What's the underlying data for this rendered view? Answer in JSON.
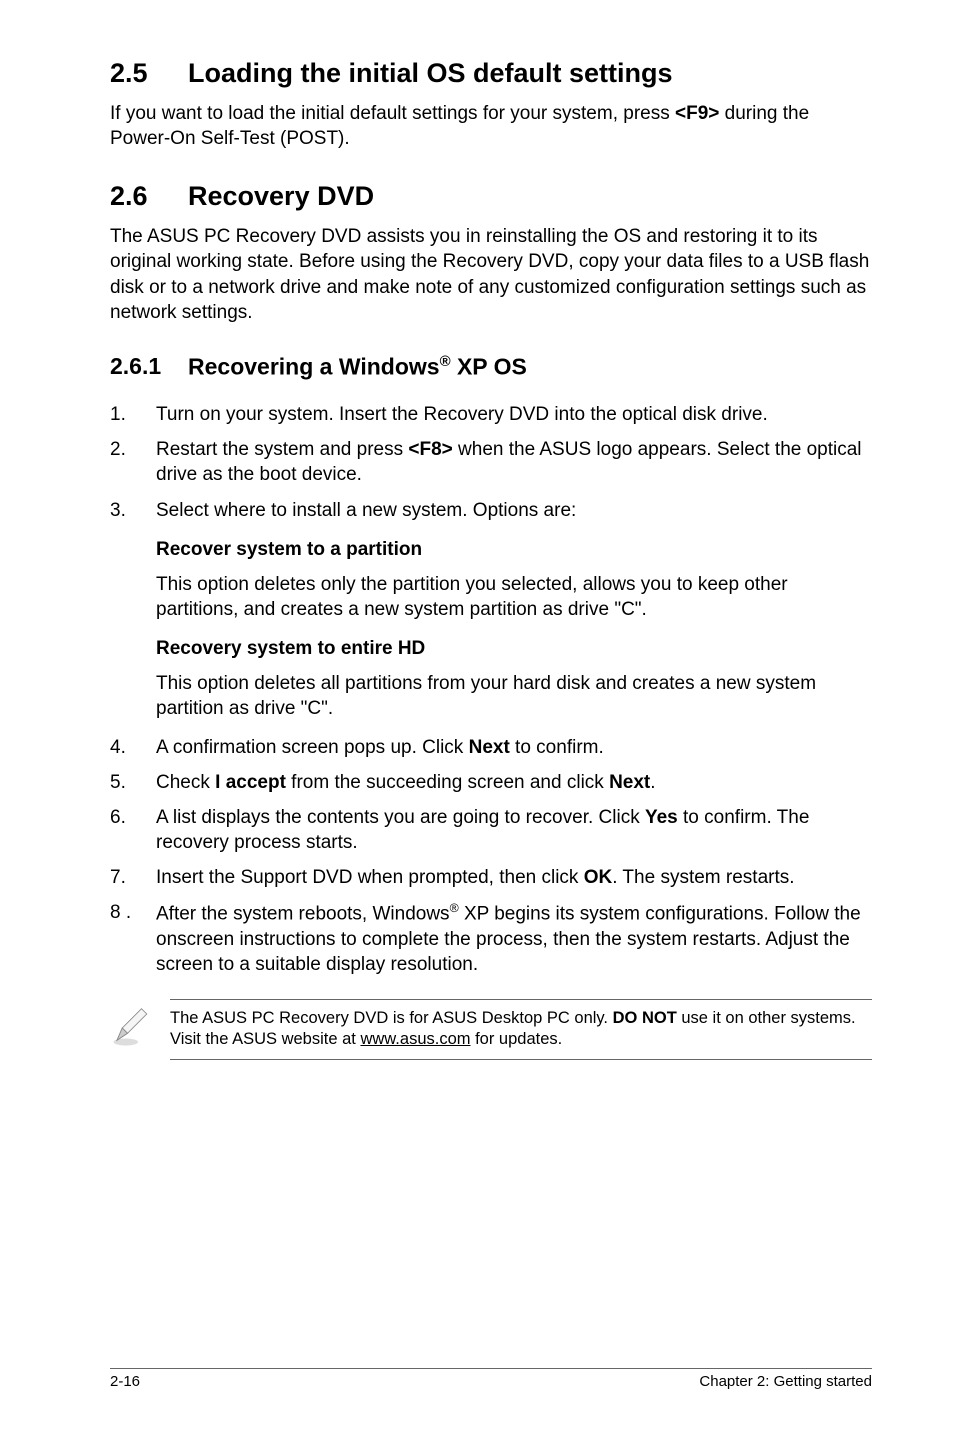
{
  "sec25": {
    "num": "2.5",
    "title": "Loading the initial OS default settings",
    "body_pre": "If you want to load the initial default settings for your system, press ",
    "body_key": "<F9>",
    "body_post": " during the Power-On Self-Test (POST)."
  },
  "sec26": {
    "num": "2.6",
    "title": "Recovery DVD",
    "body": "The ASUS PC Recovery DVD assists you in reinstalling the OS and restoring it to its original working state. Before using the Recovery DVD, copy your data files to a USB flash disk or to a network drive and make note of any customized configuration settings such as network settings."
  },
  "sec261": {
    "num": "2.6.1",
    "title_pre": "Recovering a Windows",
    "title_sup": "®",
    "title_post": " XP OS"
  },
  "steps_a": [
    {
      "n": "1.",
      "text": "Turn on your system. Insert the Recovery DVD into the optical disk drive."
    },
    {
      "n": "2.",
      "pre": "Restart the system and press ",
      "b": "<F8>",
      "post": " when the ASUS logo appears. Select the optical drive as the boot device."
    },
    {
      "n": "3.",
      "text": "Select where to install a new system. Options are:"
    }
  ],
  "options": [
    {
      "head": "Recover system to a partition",
      "text": "This option deletes only the partition you selected, allows you to keep other partitions, and creates a new system partition as drive \"C\"."
    },
    {
      "head": "Recovery system to entire HD",
      "text": "This option deletes all partitions from your hard disk and creates a new system partition as drive \"C\"."
    }
  ],
  "steps_b": [
    {
      "n": "4.",
      "pre": "A confirmation screen pops up. Click ",
      "b": "Next",
      "post": " to confirm."
    },
    {
      "n": "5.",
      "pre": "Check ",
      "b": "I accept",
      "mid": " from the succeeding screen and click ",
      "b2": "Next",
      "post": "."
    },
    {
      "n": "6.",
      "pre": "A list displays the contents you are going to recover. Click ",
      "b": "Yes",
      "post": " to confirm. The recovery process starts."
    },
    {
      "n": "7.",
      "pre": "Insert the Support DVD when prompted, then click ",
      "b": "OK",
      "post": ". The system restarts."
    },
    {
      "n": "8 .",
      "pre": "After the system reboots, Windows",
      "sup": "®",
      "post": " XP begins its system configurations. Follow the onscreen instructions to complete the process, then the system restarts. Adjust the screen to a suitable display resolution."
    }
  ],
  "note": {
    "pre": "The ASUS PC Recovery DVD is for ASUS Desktop PC only. ",
    "b": "DO NOT",
    "mid": " use it on other systems. Visit the ASUS website at ",
    "link": "www.asus.com",
    "post": " for updates."
  },
  "footer": {
    "left": "2-16",
    "right": "Chapter 2: Getting started"
  }
}
